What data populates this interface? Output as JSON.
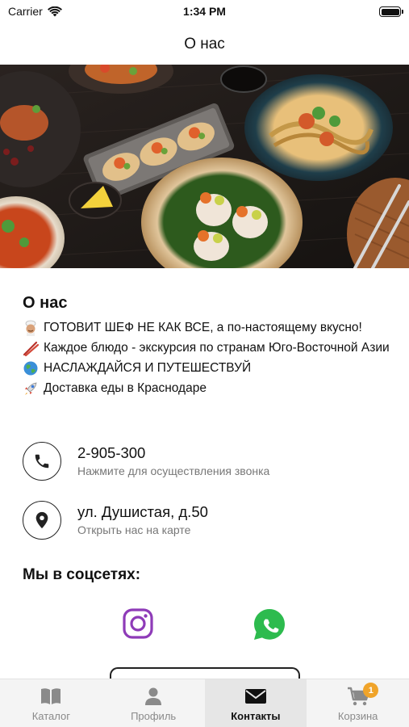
{
  "status_bar": {
    "carrier": "Carrier",
    "time": "1:34 PM"
  },
  "nav": {
    "title": "О нас"
  },
  "about": {
    "title": "О нас",
    "lines": [
      {
        "icon": "chef-emoji",
        "text": "ГОТОВИТ ШЕФ НЕ КАК ВСЕ, а по-настоящему вкусно!"
      },
      {
        "icon": "chopsticks-emoji",
        "text": "Каждое блюдо - экскурсия по странам Юго-Восточной Азии"
      },
      {
        "icon": "globe-emoji",
        "text": "НАСЛАЖДАЙСЯ И ПУТЕШЕСТВУЙ"
      },
      {
        "icon": "rocket-emoji",
        "text": "Доставка еды в Краснодаре"
      }
    ]
  },
  "contacts": {
    "phone": {
      "number": "2-905-300",
      "hint": "Нажмите для осуществления звонка"
    },
    "address": {
      "text": "ул. Душистая, д.50",
      "hint": "Открыть нас на карте"
    }
  },
  "social": {
    "title": "Мы в соцсетях:",
    "items": [
      {
        "name": "instagram",
        "icon": "instagram-icon",
        "color": "#8e3bb8"
      },
      {
        "name": "whatsapp",
        "icon": "whatsapp-icon",
        "color": "#2dbb4e"
      }
    ]
  },
  "tabs": [
    {
      "label": "Каталог",
      "icon": "book-icon",
      "active": false
    },
    {
      "label": "Профиль",
      "icon": "person-icon",
      "active": false
    },
    {
      "label": "Контакты",
      "icon": "envelope-icon",
      "active": true
    },
    {
      "label": "Корзина",
      "icon": "cart-icon",
      "active": false,
      "badge": "1"
    }
  ],
  "colors": {
    "badge": "#f0a42a",
    "accent_text": "#111111",
    "muted_text": "#777777"
  }
}
